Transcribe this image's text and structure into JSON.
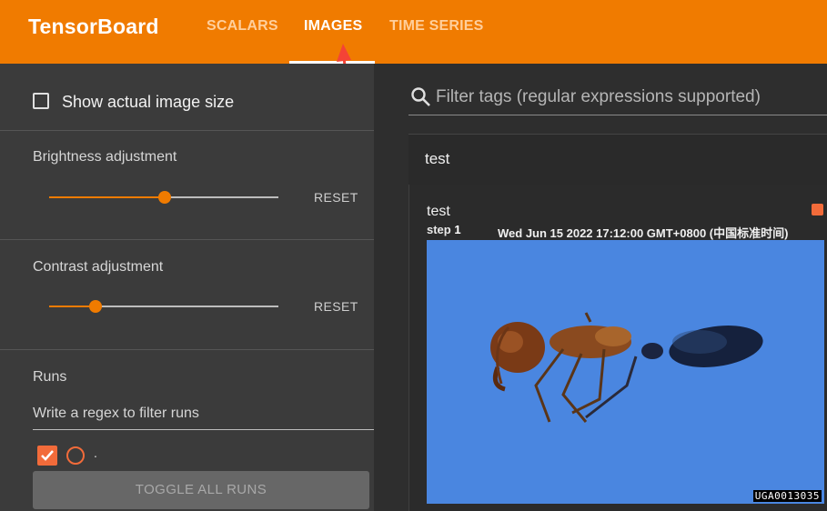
{
  "app": {
    "title": "TensorBoard"
  },
  "tabs": [
    {
      "label": "SCALARS"
    },
    {
      "label": "IMAGES"
    },
    {
      "label": "TIME SERIES"
    }
  ],
  "sidebar": {
    "show_actual_size_label": "Show actual image size",
    "brightness": {
      "title": "Brightness adjustment",
      "value": 0.5,
      "reset_label": "RESET"
    },
    "contrast": {
      "title": "Contrast adjustment",
      "value": 0.2,
      "reset_label": "RESET"
    },
    "runs": {
      "title": "Runs",
      "filter_placeholder": "Write a regex to filter runs",
      "items": [
        {
          "name": "."
        }
      ],
      "toggle_all_label": "TOGGLE ALL RUNS"
    }
  },
  "main": {
    "filter_placeholder": "Filter tags (regular expressions supported)",
    "group": {
      "title": "test"
    },
    "card": {
      "title": "test",
      "step_label": "step",
      "step_value": "1",
      "timestamp": "Wed Jun 15 2022 17:12:00 GMT+0800 (中国标准时间)",
      "watermark": "UGA0013035"
    }
  },
  "colors": {
    "accent": "#f07b00",
    "checkbox": "#f26b3a",
    "image_bg": "#4a86e0"
  }
}
